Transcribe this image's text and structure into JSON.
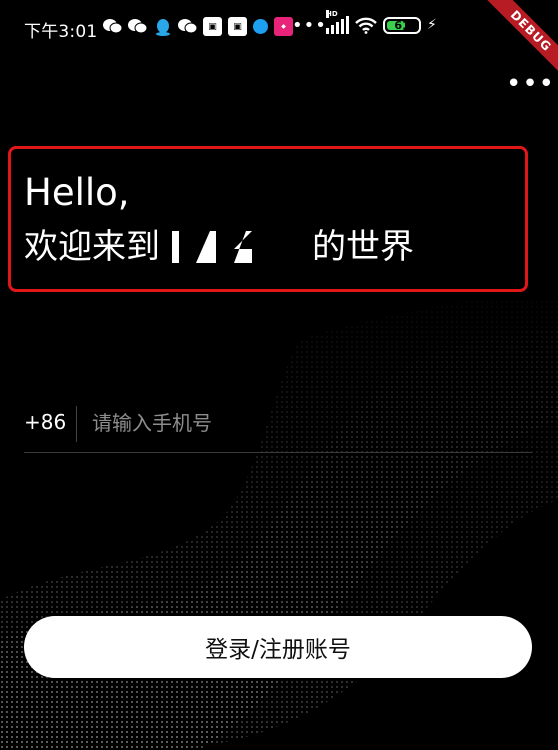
{
  "status_bar": {
    "time": "下午3:01",
    "more_apps": "•••",
    "network_label": "HD",
    "battery": "61",
    "battery_level": 0.61,
    "notification_icons": [
      "wechat-icon",
      "wechat-icon",
      "qq-icon",
      "wechat-icon",
      "box-app-icon",
      "box-app-icon",
      "blue-app-icon",
      "pink-app-icon"
    ]
  },
  "debug_banner": "DEBUG",
  "header": {
    "more_label": "•••"
  },
  "greeting": {
    "line1": "Hello,",
    "line2_prefix": "欢迎来到",
    "line2_suffix": "的世界"
  },
  "phone_form": {
    "country_code": "+86",
    "placeholder": "请输入手机号",
    "value": ""
  },
  "login_button": {
    "label": "登录/注册账号"
  },
  "colors": {
    "background": "#000000",
    "highlight_border": "#e01717",
    "button_bg": "#ffffff",
    "placeholder": "#8d8d8d",
    "battery": "#3ccf4e",
    "debug_ribbon": "#b71c24"
  }
}
